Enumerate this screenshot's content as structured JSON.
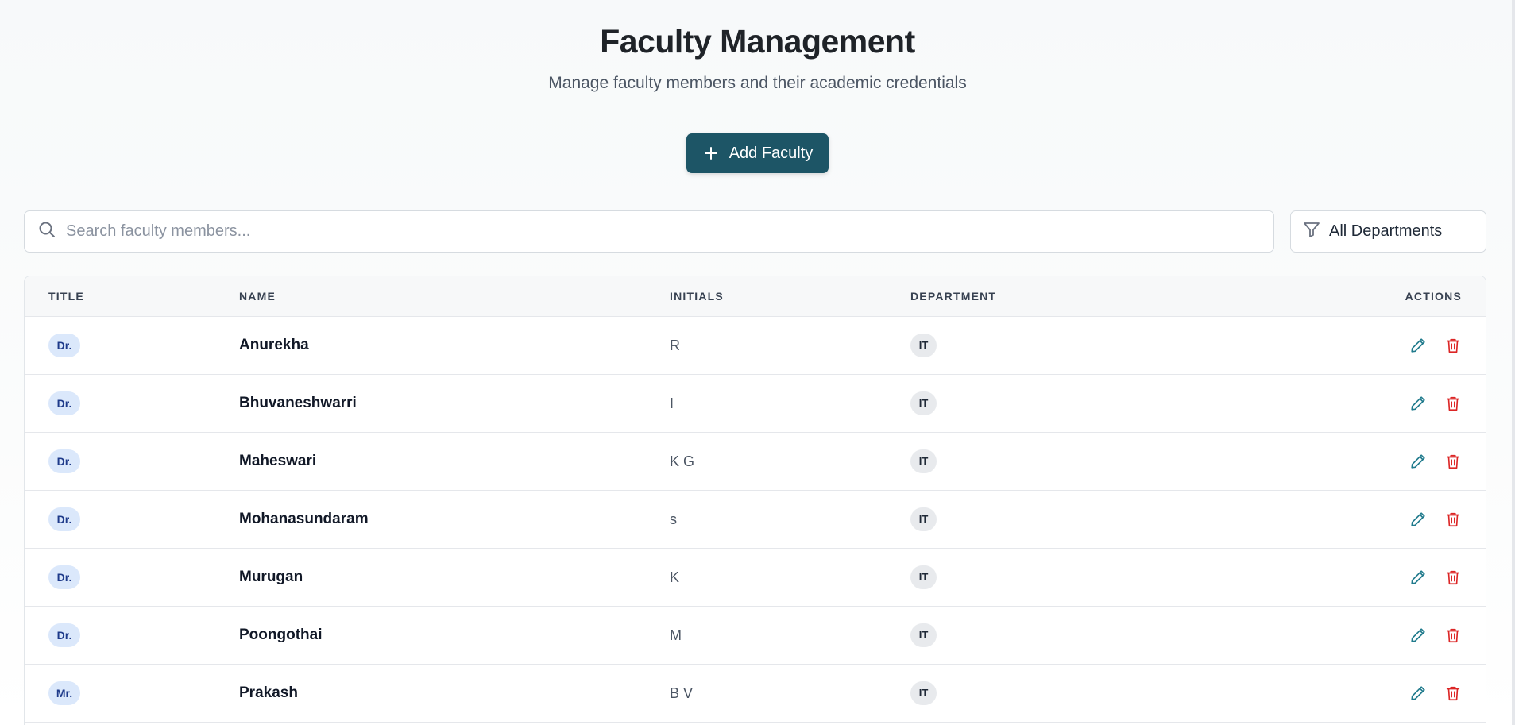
{
  "header": {
    "title": "Faculty Management",
    "subtitle": "Manage faculty members and their academic credentials"
  },
  "toolbar": {
    "add_label": "Add Faculty",
    "add_icon": "plus-icon"
  },
  "search": {
    "placeholder": "Search faculty members...",
    "value": ""
  },
  "filter": {
    "selected": "All Departments",
    "icon": "filter-icon"
  },
  "table": {
    "columns": {
      "title": "TITLE",
      "name": "NAME",
      "initials": "INITIALS",
      "department": "DEPARTMENT",
      "actions": "ACTIONS"
    },
    "rows": [
      {
        "title": "Dr.",
        "name": "Anurekha",
        "initials": "R",
        "department": "IT"
      },
      {
        "title": "Dr.",
        "name": "Bhuvaneshwarri",
        "initials": "I",
        "department": "IT"
      },
      {
        "title": "Dr.",
        "name": "Maheswari",
        "initials": "K G",
        "department": "IT"
      },
      {
        "title": "Dr.",
        "name": "Mohanasundaram",
        "initials": "s",
        "department": "IT"
      },
      {
        "title": "Dr.",
        "name": "Murugan",
        "initials": "K",
        "department": "IT"
      },
      {
        "title": "Dr.",
        "name": "Poongothai",
        "initials": "M",
        "department": "IT"
      },
      {
        "title": "Mr.",
        "name": "Prakash",
        "initials": "B V",
        "department": "IT"
      }
    ]
  },
  "colors": {
    "primary": "#1d5566",
    "edit": "#1f7a8c",
    "delete": "#dc2626",
    "title_badge_bg": "#dbe8fb",
    "dept_badge_bg": "#e8eaed"
  }
}
